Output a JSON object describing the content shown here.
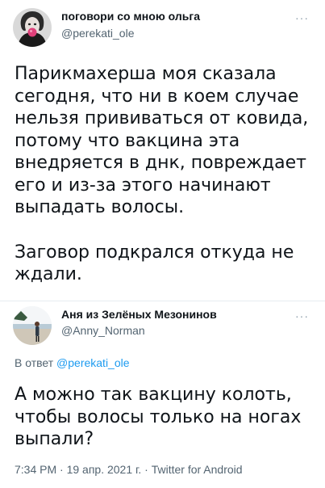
{
  "tweet1": {
    "author_name": "поговори со мною ольга",
    "author_handle": "@perekati_ole",
    "more_label": "···",
    "paragraph1": "Парикмахерша моя сказала сегодня, что ни в коем случае нельзя прививаться от ковида, потому что вакцина эта внедряется в днк, повреждает его и из-за этого начинают выпадать волосы.",
    "paragraph2": "Заговор подкрался откуда не ждали."
  },
  "tweet2": {
    "author_name": "Аня из Зелёных Мезонинов",
    "author_handle": "@Anny_Norman",
    "more_label": "···",
    "reply_prefix": "В ответ",
    "reply_handle": "@perekati_ole",
    "text": "А можно так вакцину колоть, чтобы волосы только на ногах выпали?",
    "meta": "7:34 PM · 19 апр. 2021 г. · Twitter for Android"
  }
}
